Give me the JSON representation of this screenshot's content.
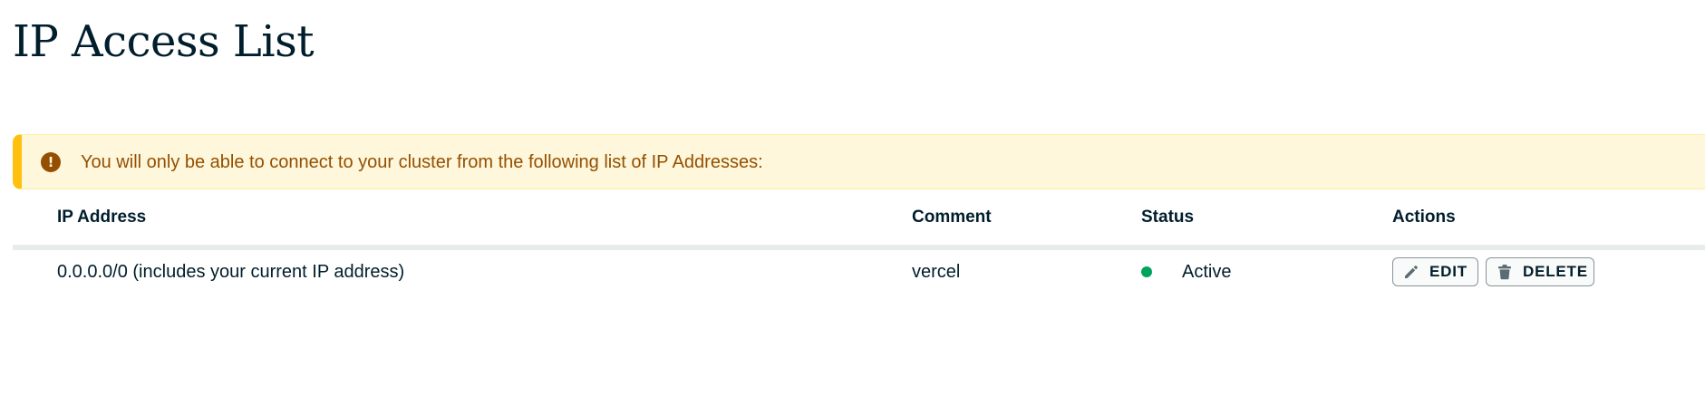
{
  "page": {
    "title": "IP Access List"
  },
  "banner": {
    "icon": "warning-icon",
    "icon_glyph": "!",
    "message": "You will only be able to connect to your cluster from the following list of IP Addresses:",
    "accent_color": "#ffc010",
    "background_color": "#fef7db",
    "text_color": "#944f01"
  },
  "table": {
    "columns": [
      "IP Address",
      "Comment",
      "Status",
      "Actions"
    ],
    "rows": [
      {
        "ip_address": "0.0.0.0/0  (includes your current IP address)",
        "comment": "vercel",
        "status": "Active",
        "status_color": "#00a35c",
        "actions": {
          "edit": {
            "label": "EDIT",
            "icon": "pencil-icon"
          },
          "delete": {
            "label": "DELETE",
            "icon": "trash-icon"
          }
        }
      }
    ]
  }
}
